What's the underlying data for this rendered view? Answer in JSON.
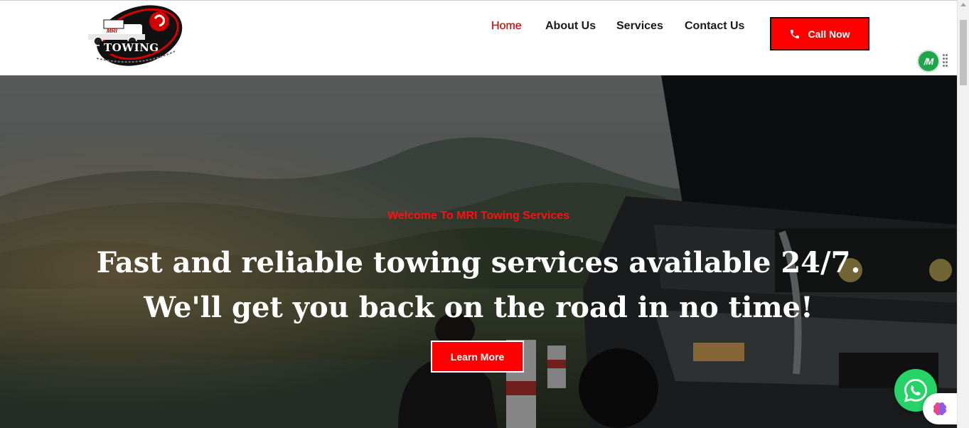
{
  "logo": {
    "brand_small": "MRI",
    "brand_main": "TOWING"
  },
  "nav": {
    "items": [
      {
        "label": "Home",
        "active": true
      },
      {
        "label": "About Us",
        "active": false
      },
      {
        "label": "Services",
        "active": false
      },
      {
        "label": "Contact Us",
        "active": false
      }
    ],
    "cta_label": "Call Now",
    "cta_icon": "phone-icon"
  },
  "hero": {
    "eyebrow": "Welcome To MRI Towing Services",
    "headline_line1": "Fast and reliable towing services available 24/7.",
    "headline_line2": "We'll get you back on the road in no time!",
    "button_label": "Learn More"
  },
  "widgets": {
    "extension_badge": "/M",
    "whatsapp_icon": "whatsapp-icon",
    "brain_icon": "brain-icon"
  },
  "colors": {
    "accent": "#ff0000",
    "nav_active": "#d90d0d",
    "whatsapp": "#25d366",
    "extension": "#1ea64a"
  }
}
